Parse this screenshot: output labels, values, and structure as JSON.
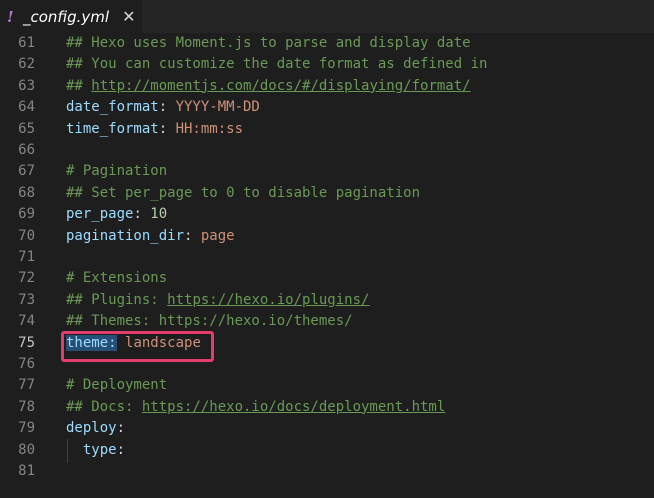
{
  "tab": {
    "icon_glyph": "!",
    "icon": "yaml-warning-icon",
    "title": "_config.yml",
    "close_glyph": "✕"
  },
  "editor": {
    "active_line": "75",
    "lines": [
      {
        "num": "61",
        "tokens": [
          {
            "t": "## Hexo uses Moment.js to parse and display date",
            "c": "c"
          }
        ]
      },
      {
        "num": "62",
        "tokens": [
          {
            "t": "## You can customize the date format as defined in",
            "c": "c"
          }
        ]
      },
      {
        "num": "63",
        "tokens": [
          {
            "t": "## ",
            "c": "c"
          },
          {
            "t": "http://momentjs.com/docs/#/displaying/format/",
            "c": "cu"
          }
        ]
      },
      {
        "num": "64",
        "tokens": [
          {
            "t": "date_format",
            "c": "k"
          },
          {
            "t": ": ",
            "c": "p"
          },
          {
            "t": "YYYY-MM-DD",
            "c": "v"
          }
        ]
      },
      {
        "num": "65",
        "tokens": [
          {
            "t": "time_format",
            "c": "k"
          },
          {
            "t": ": ",
            "c": "p"
          },
          {
            "t": "HH:mm:ss",
            "c": "v"
          }
        ]
      },
      {
        "num": "66",
        "tokens": []
      },
      {
        "num": "67",
        "tokens": [
          {
            "t": "# Pagination",
            "c": "c"
          }
        ]
      },
      {
        "num": "68",
        "tokens": [
          {
            "t": "## Set per_page to 0 to disable pagination",
            "c": "c"
          }
        ]
      },
      {
        "num": "69",
        "tokens": [
          {
            "t": "per_page",
            "c": "k"
          },
          {
            "t": ": ",
            "c": "p"
          },
          {
            "t": "10",
            "c": "n"
          }
        ]
      },
      {
        "num": "70",
        "tokens": [
          {
            "t": "pagination_dir",
            "c": "k"
          },
          {
            "t": ": ",
            "c": "p"
          },
          {
            "t": "page",
            "c": "v"
          }
        ]
      },
      {
        "num": "71",
        "tokens": []
      },
      {
        "num": "72",
        "tokens": [
          {
            "t": "# Extensions",
            "c": "c"
          }
        ]
      },
      {
        "num": "73",
        "tokens": [
          {
            "t": "## Plugins: ",
            "c": "c"
          },
          {
            "t": "https://hexo.io/plugins/",
            "c": "cu"
          }
        ]
      },
      {
        "num": "74",
        "tokens": [
          {
            "t": "## Themes: https://hexo.io/themes/",
            "c": "c"
          }
        ]
      },
      {
        "num": "75",
        "tokens": [
          {
            "t": "theme:",
            "c": "k sel"
          },
          {
            "t": " ",
            "c": "p"
          },
          {
            "t": "landscape",
            "c": "v"
          }
        ]
      },
      {
        "num": "76",
        "tokens": []
      },
      {
        "num": "77",
        "tokens": [
          {
            "t": "# Deployment",
            "c": "c"
          }
        ]
      },
      {
        "num": "78",
        "tokens": [
          {
            "t": "## Docs: ",
            "c": "c"
          },
          {
            "t": "https://hexo.io/docs/deployment.html",
            "c": "cu"
          }
        ]
      },
      {
        "num": "79",
        "tokens": [
          {
            "t": "deploy",
            "c": "k"
          },
          {
            "t": ":",
            "c": "p"
          }
        ]
      },
      {
        "num": "80",
        "tokens": [
          {
            "t": "  type",
            "c": "k"
          },
          {
            "t": ":",
            "c": "p"
          }
        ]
      },
      {
        "num": "81",
        "tokens": []
      }
    ]
  },
  "colors": {
    "background": "#1e1e1e",
    "comment": "#6a9955",
    "key": "#9cdcfe",
    "string": "#ce9178",
    "number": "#b5cea8",
    "highlight_box": "#e23d6b",
    "selection": "#264f78"
  }
}
